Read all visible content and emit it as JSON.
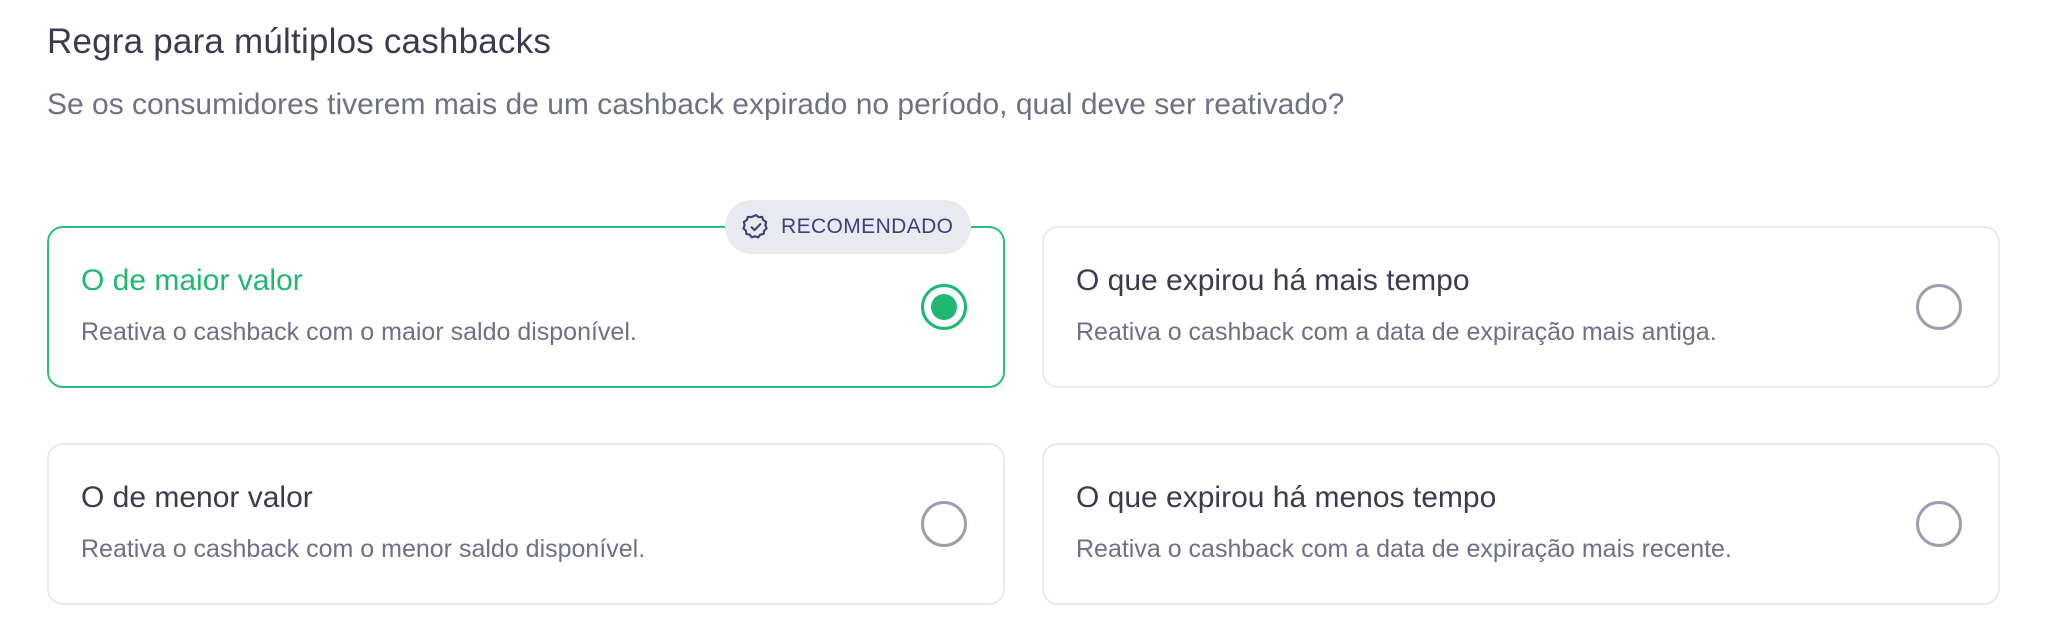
{
  "section": {
    "title": "Regra para múltiplos cashbacks",
    "subtitle": "Se os consumidores tiverem mais de um cashback expirado no período, qual deve ser reativado?"
  },
  "badge": {
    "label": "RECOMENDADO",
    "icon": "verified-badge-icon"
  },
  "options": [
    {
      "title": "O de maior valor",
      "description": "Reativa o cashback com o maior saldo disponível.",
      "selected": true
    },
    {
      "title": "O que expirou há mais tempo",
      "description": "Reativa o cashback com a data de expiração mais antiga.",
      "selected": false
    },
    {
      "title": "O de menor valor",
      "description": "Reativa o cashback com o menor saldo disponível.",
      "selected": false
    },
    {
      "title": "O que expirou há menos tempo",
      "description": "Reativa o cashback com a data de expiração mais recente.",
      "selected": false
    }
  ],
  "colors": {
    "accent": "#1fb872",
    "selected_border": "#2bbf7b",
    "badge_bg": "#e9e9f0",
    "badge_text": "#3f3f7a"
  }
}
